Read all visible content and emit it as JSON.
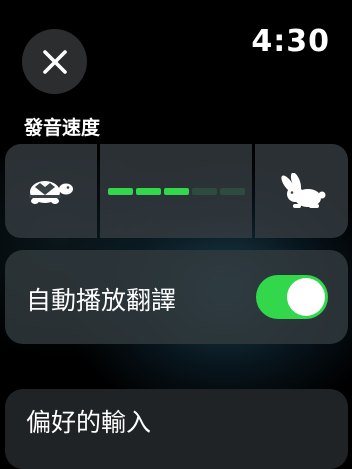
{
  "status_bar": {
    "time": "4:30"
  },
  "close_button": {
    "icon": "close-icon"
  },
  "speech_rate": {
    "label": "發音速度",
    "slow_icon": "turtle-icon",
    "fast_icon": "rabbit-icon",
    "level": 3,
    "max_level": 5,
    "accent_color": "#32d74b"
  },
  "auto_play": {
    "label": "自動播放翻譯",
    "enabled": true
  },
  "preferred_input": {
    "label": "偏好的輸入"
  }
}
